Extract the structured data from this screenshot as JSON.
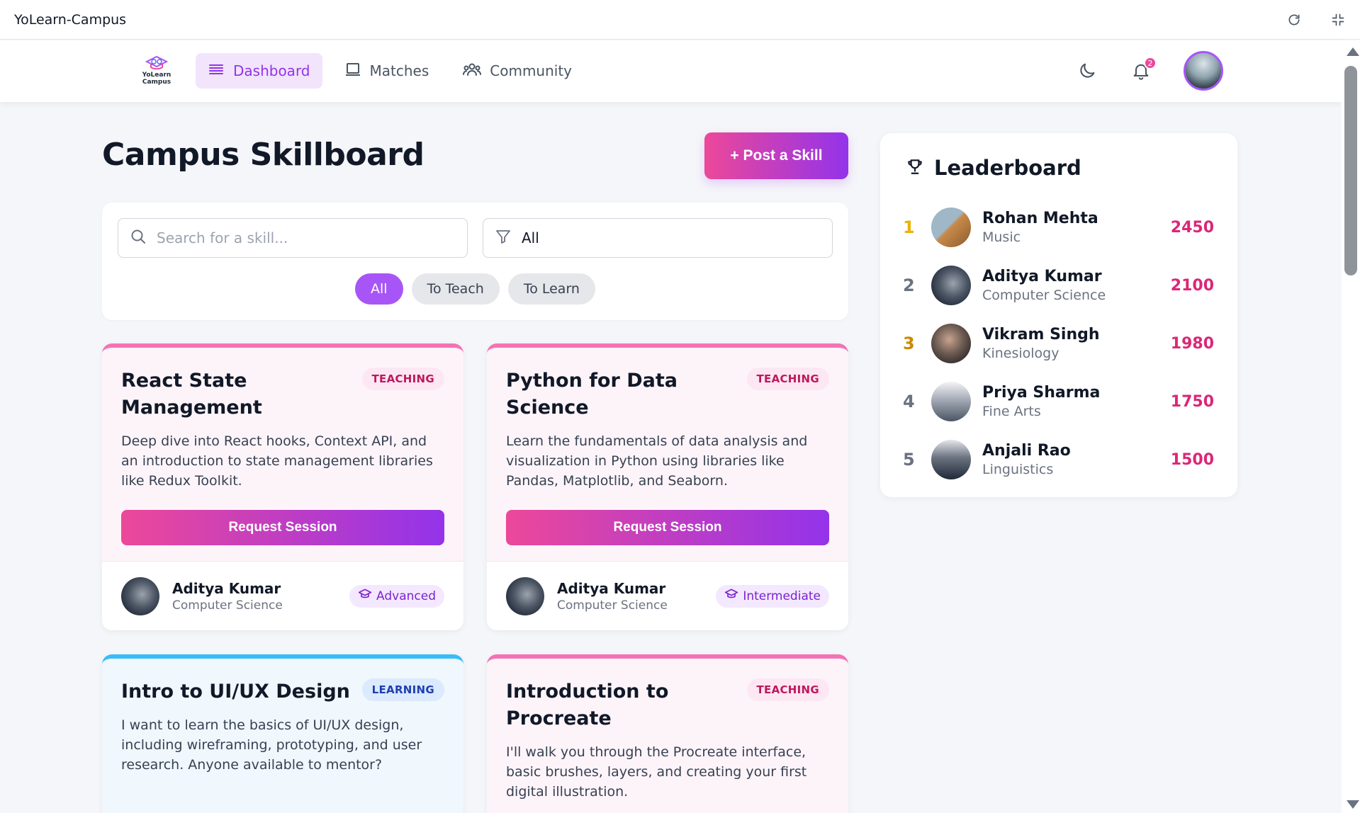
{
  "window": {
    "title": "YoLearn-Campus"
  },
  "nav": {
    "logo_text": "YoLearn Campus",
    "links": [
      {
        "label": "Dashboard",
        "icon": "menu-icon",
        "active": true
      },
      {
        "label": "Matches",
        "icon": "laptop-icon",
        "active": false
      },
      {
        "label": "Community",
        "icon": "users-icon",
        "active": false
      }
    ],
    "notification_count": "2"
  },
  "main": {
    "title": "Campus Skillboard",
    "post_button": "+ Post a Skill",
    "search_placeholder": "Search for a skill...",
    "filter_value": "All",
    "pills": [
      "All",
      "To Teach",
      "To Learn"
    ]
  },
  "cards": [
    {
      "title": "React State Management",
      "badge": "TEACHING",
      "description": "Deep dive into React hooks, Context API, and an introduction to state management libraries like Redux Toolkit.",
      "button": "Request Session",
      "author": "Aditya Kumar",
      "dept": "Computer Science",
      "level": "Advanced"
    },
    {
      "title": "Python for Data Science",
      "badge": "TEACHING",
      "description": "Learn the fundamentals of data analysis and visualization in Python using libraries like Pandas, Matplotlib, and Seaborn.",
      "button": "Request Session",
      "author": "Aditya Kumar",
      "dept": "Computer Science",
      "level": "Intermediate"
    },
    {
      "title": "Intro to UI/UX Design",
      "badge": "LEARNING",
      "description": "I want to learn the basics of UI/UX design, including wireframing, prototyping, and user research. Anyone available to mentor?"
    },
    {
      "title": "Introduction to Procreate",
      "badge": "TEACHING",
      "description": "I'll walk you through the Procreate interface, basic brushes, layers, and creating your first digital illustration."
    }
  ],
  "leaderboard": {
    "title": "Leaderboard",
    "entries": [
      {
        "rank": "1",
        "name": "Rohan Mehta",
        "dept": "Music",
        "score": "2450"
      },
      {
        "rank": "2",
        "name": "Aditya Kumar",
        "dept": "Computer Science",
        "score": "2100"
      },
      {
        "rank": "3",
        "name": "Vikram Singh",
        "dept": "Kinesiology",
        "score": "1980"
      },
      {
        "rank": "4",
        "name": "Priya Sharma",
        "dept": "Fine Arts",
        "score": "1750"
      },
      {
        "rank": "5",
        "name": "Anjali Rao",
        "dept": "Linguistics",
        "score": "1500"
      }
    ]
  },
  "colors": {
    "accent_pink": "#ec4899",
    "accent_purple": "#9333ea",
    "teach_border": "#f472b6",
    "learn_border": "#38bdf8",
    "score": "#db2777"
  }
}
